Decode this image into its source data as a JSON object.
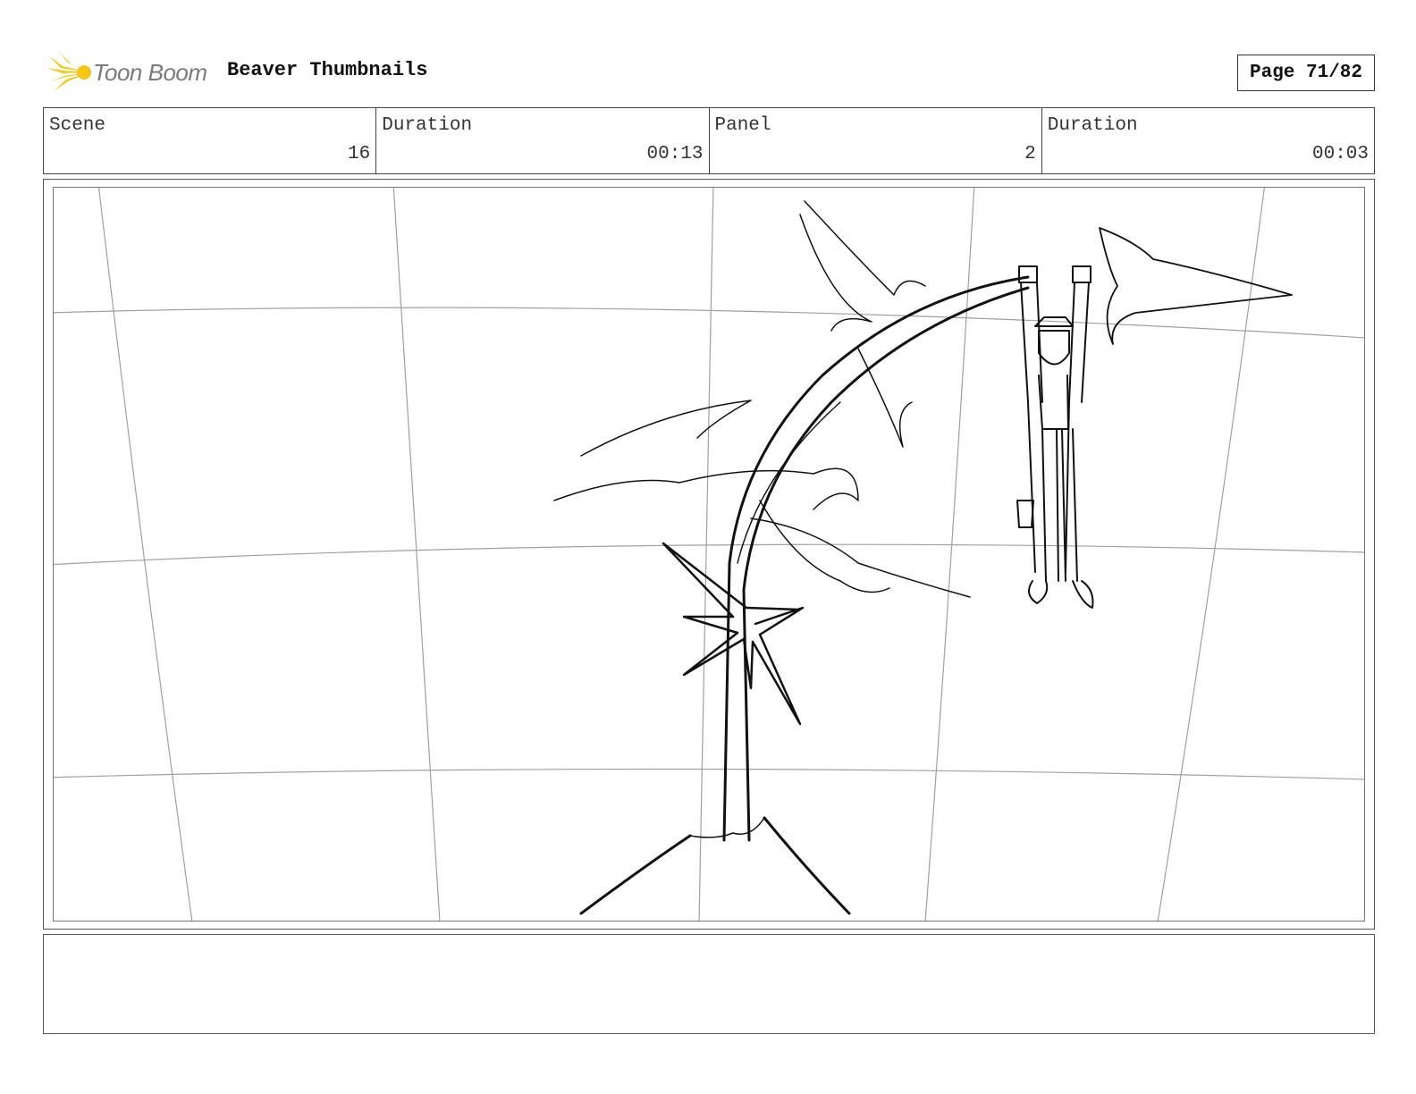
{
  "header": {
    "logo_text": "Toon Boom",
    "project_title": "Beaver Thumbnails",
    "page_label": "Page 71/82"
  },
  "info": {
    "scene_label": "Scene",
    "scene_value": "16",
    "scene_duration_label": "Duration",
    "scene_duration_value": "00:13",
    "panel_label": "Panel",
    "panel_value": "2",
    "panel_duration_label": "Duration",
    "panel_duration_value": "00:03"
  },
  "notes": {
    "text": ""
  },
  "colors": {
    "logo_accent": "#f5c518",
    "border": "#444444",
    "sketch": "#111111",
    "guide_lines": "#9a9a9a"
  },
  "icons": {
    "logo": "toon-boom-starburst-icon"
  }
}
